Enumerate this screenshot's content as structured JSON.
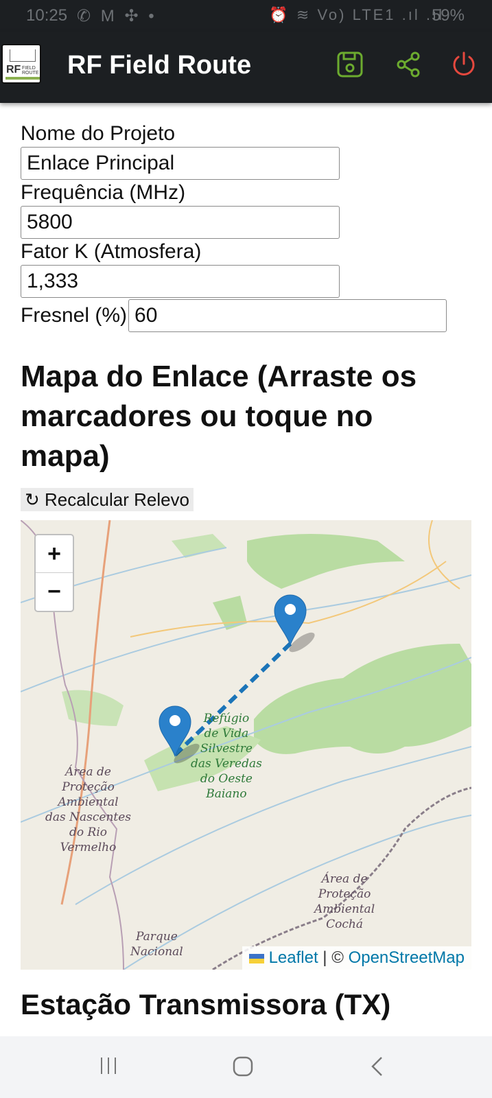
{
  "status_bar": {
    "time": "10:25",
    "left_icons": "✆ M ✣ •",
    "right_icons": "⏰ ≋ Vo) LTE1 .ıl .ıl",
    "battery": "59%"
  },
  "app_bar": {
    "title": "RF Field Route",
    "logo_text": "RF",
    "logo_small": "FIELD ROUTE",
    "icons": [
      "save-icon",
      "share-icon",
      "power-icon"
    ],
    "colors": {
      "save": "#6cab2f",
      "share": "#6cab2f",
      "power": "#e5483e"
    }
  },
  "form": {
    "project_label": "Nome do Projeto",
    "project_value": "Enlace Principal",
    "freq_label": "Frequência (MHz)",
    "freq_value": "5800",
    "k_label": "Fator K (Atmosfera)",
    "k_value": "1,333",
    "fresnel_label": "Fresnel (%)",
    "fresnel_value": "60"
  },
  "map_section": {
    "title": "Mapa do Enlace (Arraste os marcadores ou toque no mapa)",
    "recalc_button": "Recalcular Relevo",
    "zoom_in": "+",
    "zoom_out": "−",
    "attribution_leaflet": "Leaflet",
    "attribution_sep": " | © ",
    "attribution_osm": "OpenStreetMap",
    "labels": {
      "refugio": "Refúgio\nde Vida\nSilvestre\ndas Veredas\ndo Oeste\nBaiano",
      "apa_nascentes": "Área de\nProteção\nAmbiental\ndas Nascentes\ndo Rio\nVermelho",
      "apa_cocha": "Área de\nProteção\nAmbiental\nCochá",
      "parque": "Parque\nNacional"
    },
    "colors": {
      "link_line": "#1b74b8",
      "marker": "#2a81cb"
    }
  },
  "tx_section": {
    "title": "Estação Transmissora (TX)"
  },
  "nav_bar": {
    "recents": "|||",
    "home": "○",
    "back": "<"
  }
}
